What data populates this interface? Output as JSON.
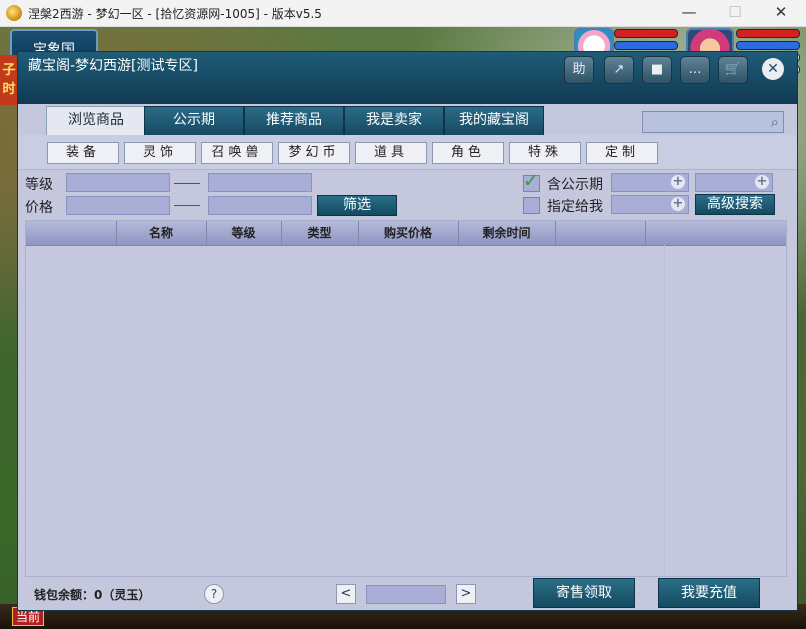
{
  "window": {
    "title": "涅槃2西游 - 梦幻一区 - [拾忆资源网-1005] - 版本v5.5",
    "min_label": "—",
    "max_label": "☐",
    "close_label": "✕"
  },
  "scene": {
    "map_name": "宝象国",
    "side_text": "子时",
    "hotbar_label": "当前"
  },
  "dialog": {
    "title": "藏宝阁-梦幻西游[测试专区]",
    "header_buttons": [
      "助",
      "↗",
      "■",
      "…",
      "🛒"
    ],
    "close_label": "✕",
    "tabs": [
      "浏览商品",
      "公示期",
      "推荐商品",
      "我是卖家",
      "我的藏宝阁"
    ],
    "active_tab": "浏览商品",
    "search": {
      "value": "",
      "icon": "search-icon"
    },
    "categories": [
      "装备",
      "灵饰",
      "召唤兽",
      "梦幻币",
      "道具",
      "角色",
      "特殊",
      "定制"
    ],
    "filters": {
      "level_label": "等级",
      "price_label": "价格",
      "filter_button": "筛选",
      "public_label": "含公示期",
      "public_checked": true,
      "assigned_label": "指定给我",
      "assigned_checked": false,
      "advanced_button": "高级搜索"
    },
    "table": {
      "columns": [
        "",
        "名称",
        "等级",
        "类型",
        "购买价格",
        "剩余时间",
        "",
        ""
      ],
      "rows": []
    },
    "footer": {
      "wallet_text": "钱包余额：0（灵玉）",
      "help_label": "?",
      "prev_label": "<",
      "next_label": ">",
      "page_value": "",
      "sell_button": "寄售领取",
      "recharge_button": "我要充值"
    }
  }
}
